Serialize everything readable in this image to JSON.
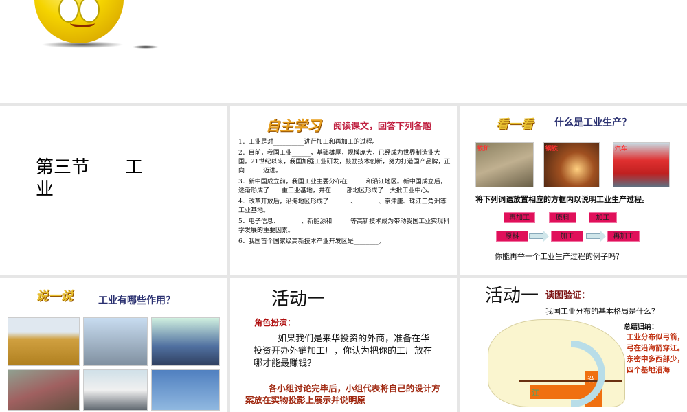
{
  "slide1": {
    "title": "第三节　　工业"
  },
  "slide2": {
    "logo": "自主学习",
    "header": "阅读课文，回答下列各题",
    "questions": [
      "1．工业是对__________进行加工和再加工的过程。",
      "2．目前，我国工业______，基础雄厚，规模庞大，已经成为世界制造业大国。21世纪以来，我国加强工业研发，鼓励技术创新，努力打造国产品牌，正向______迈进。",
      "3．新中国成立前，我国工业主要分布在______和沿江地区。新中国成立后，逐渐形成了____重工业基地，并在_____部地区形成了一大批工业中心。",
      "4．改革开放后，沿海地区形成了_______、_______、京津唐、珠江三角洲等工业基地。",
      "5．电子信息、_______、新能源和______等高新技术成为带动我国工业实现科学发展的重要因素。",
      "6．我国首个国家级高新技术产业开发区是________。"
    ]
  },
  "slide3": {
    "logo": "看一看",
    "title": "什么是工业生产？",
    "pics": [
      "铁矿",
      "钢铁",
      "汽车"
    ],
    "instruction": "将下列词语放置相应的方框内以说明工业生产过程。",
    "words": [
      "再加工",
      "原料",
      "加工"
    ],
    "flow": [
      "原料",
      "加工",
      "再加工"
    ],
    "question": "你能再举一个工业生产过程的例子吗？"
  },
  "slide4": {
    "logo": "说一说",
    "title": "工业有哪些作用？"
  },
  "slide5": {
    "title": "活动一",
    "subtitle": "角色扮演：",
    "body": "如果我们是来华投资的外商，准备在华投资开办外销加工厂，你认为把你的工厂放在哪才能最赚钱？",
    "task": "各小组讨论完毕后，小组代表将自己的设计方案放在实物投影上展示并说明原"
  },
  "slide6": {
    "title": "活动一",
    "subtitle": "读图验证：",
    "question": "我国工业分布的基本格局是什么？",
    "summary_title": "总结归纳：",
    "summary": [
      "工业分布似弓箭，",
      "弓在沿海箭穿江。",
      "东密中多西部少，",
      "四个基地沿海"
    ],
    "map_labels": [
      "沿",
      "江"
    ]
  },
  "colors": {
    "tag": "#e0105a",
    "navy": "#2a3070",
    "red": "#c03010"
  }
}
